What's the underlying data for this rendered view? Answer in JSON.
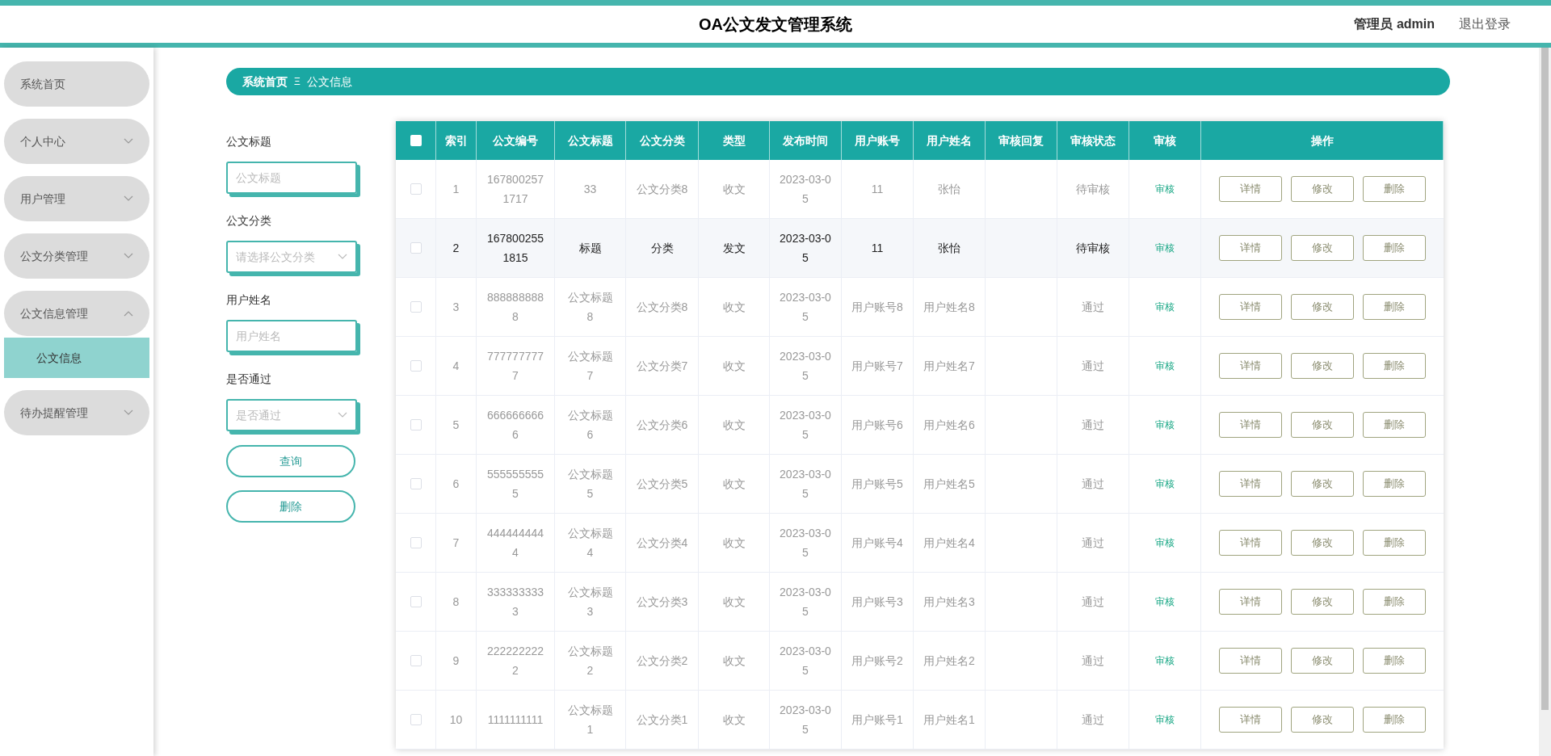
{
  "header": {
    "title": "OA公文发文管理系统",
    "user": "管理员 admin",
    "logout": "退出登录"
  },
  "sidebar": {
    "items": [
      {
        "label": "系统首页"
      },
      {
        "label": "个人中心",
        "expanded": false
      },
      {
        "label": "用户管理",
        "expanded": false
      },
      {
        "label": "公文分类管理",
        "expanded": false
      },
      {
        "label": "公文信息管理",
        "expanded": true,
        "children": [
          {
            "label": "公文信息",
            "selected": true
          }
        ]
      },
      {
        "label": "待办提醒管理",
        "expanded": false
      }
    ]
  },
  "breadcrumb": {
    "home": "系统首页",
    "separator": "Ξ",
    "current": "公文信息"
  },
  "filters": [
    {
      "kind": "input",
      "label": "公文标题",
      "placeholder": "公文标题"
    },
    {
      "kind": "select",
      "label": "公文分类",
      "placeholder": "请选择公文分类"
    },
    {
      "kind": "input",
      "label": "用户姓名",
      "placeholder": "用户姓名"
    },
    {
      "kind": "select",
      "label": "是否通过",
      "placeholder": "是否通过"
    }
  ],
  "filter_buttons": [
    "查询",
    "删除"
  ],
  "table": {
    "columns": [
      "索引",
      "公文编号",
      "公文标题",
      "公文分类",
      "类型",
      "发布时间",
      "用户账号",
      "用户姓名",
      "审核回复",
      "审核状态",
      "审核",
      "操作"
    ],
    "select_all": false,
    "rows": [
      {
        "checked": false,
        "hovered": false,
        "cells": [
          "1",
          "1678002571717",
          "33",
          "公文分类8",
          "收文",
          "2023-03-05",
          "11",
          "张怡",
          "",
          "待审核"
        ],
        "review": "审核",
        "actions": [
          "详情",
          "修改",
          "删除"
        ]
      },
      {
        "checked": false,
        "hovered": true,
        "cells": [
          "2",
          "1678002551815",
          "标题",
          "分类",
          "发文",
          "2023-03-05",
          "11",
          "张怡",
          "",
          "待审核"
        ],
        "review": "审核",
        "actions": [
          "详情",
          "修改",
          "删除"
        ]
      },
      {
        "checked": false,
        "hovered": false,
        "cells": [
          "3",
          "8888888888",
          "公文标题8",
          "公文分类8",
          "收文",
          "2023-03-05",
          "用户账号8",
          "用户姓名8",
          "",
          "通过"
        ],
        "review": "审核",
        "actions": [
          "详情",
          "修改",
          "删除"
        ]
      },
      {
        "checked": false,
        "hovered": false,
        "cells": [
          "4",
          "7777777777",
          "公文标题7",
          "公文分类7",
          "收文",
          "2023-03-05",
          "用户账号7",
          "用户姓名7",
          "",
          "通过"
        ],
        "review": "审核",
        "actions": [
          "详情",
          "修改",
          "删除"
        ]
      },
      {
        "checked": false,
        "hovered": false,
        "cells": [
          "5",
          "6666666666",
          "公文标题6",
          "公文分类6",
          "收文",
          "2023-03-05",
          "用户账号6",
          "用户姓名6",
          "",
          "通过"
        ],
        "review": "审核",
        "actions": [
          "详情",
          "修改",
          "删除"
        ]
      },
      {
        "checked": false,
        "hovered": false,
        "cells": [
          "6",
          "5555555555",
          "公文标题5",
          "公文分类5",
          "收文",
          "2023-03-05",
          "用户账号5",
          "用户姓名5",
          "",
          "通过"
        ],
        "review": "审核",
        "actions": [
          "详情",
          "修改",
          "删除"
        ]
      },
      {
        "checked": false,
        "hovered": false,
        "cells": [
          "7",
          "4444444444",
          "公文标题4",
          "公文分类4",
          "收文",
          "2023-03-05",
          "用户账号4",
          "用户姓名4",
          "",
          "通过"
        ],
        "review": "审核",
        "actions": [
          "详情",
          "修改",
          "删除"
        ]
      },
      {
        "checked": false,
        "hovered": false,
        "cells": [
          "8",
          "3333333333",
          "公文标题3",
          "公文分类3",
          "收文",
          "2023-03-05",
          "用户账号3",
          "用户姓名3",
          "",
          "通过"
        ],
        "review": "审核",
        "actions": [
          "详情",
          "修改",
          "删除"
        ]
      },
      {
        "checked": false,
        "hovered": false,
        "cells": [
          "9",
          "2222222222",
          "公文标题2",
          "公文分类2",
          "收文",
          "2023-03-05",
          "用户账号2",
          "用户姓名2",
          "",
          "通过"
        ],
        "review": "审核",
        "actions": [
          "详情",
          "修改",
          "删除"
        ]
      },
      {
        "checked": false,
        "hovered": false,
        "cells": [
          "10",
          "1111111111",
          "公文标题1",
          "公文分类1",
          "收文",
          "2023-03-05",
          "用户账号1",
          "用户姓名1",
          "",
          "通过"
        ],
        "review": "审核",
        "actions": [
          "详情",
          "修改",
          "删除"
        ]
      }
    ]
  }
}
